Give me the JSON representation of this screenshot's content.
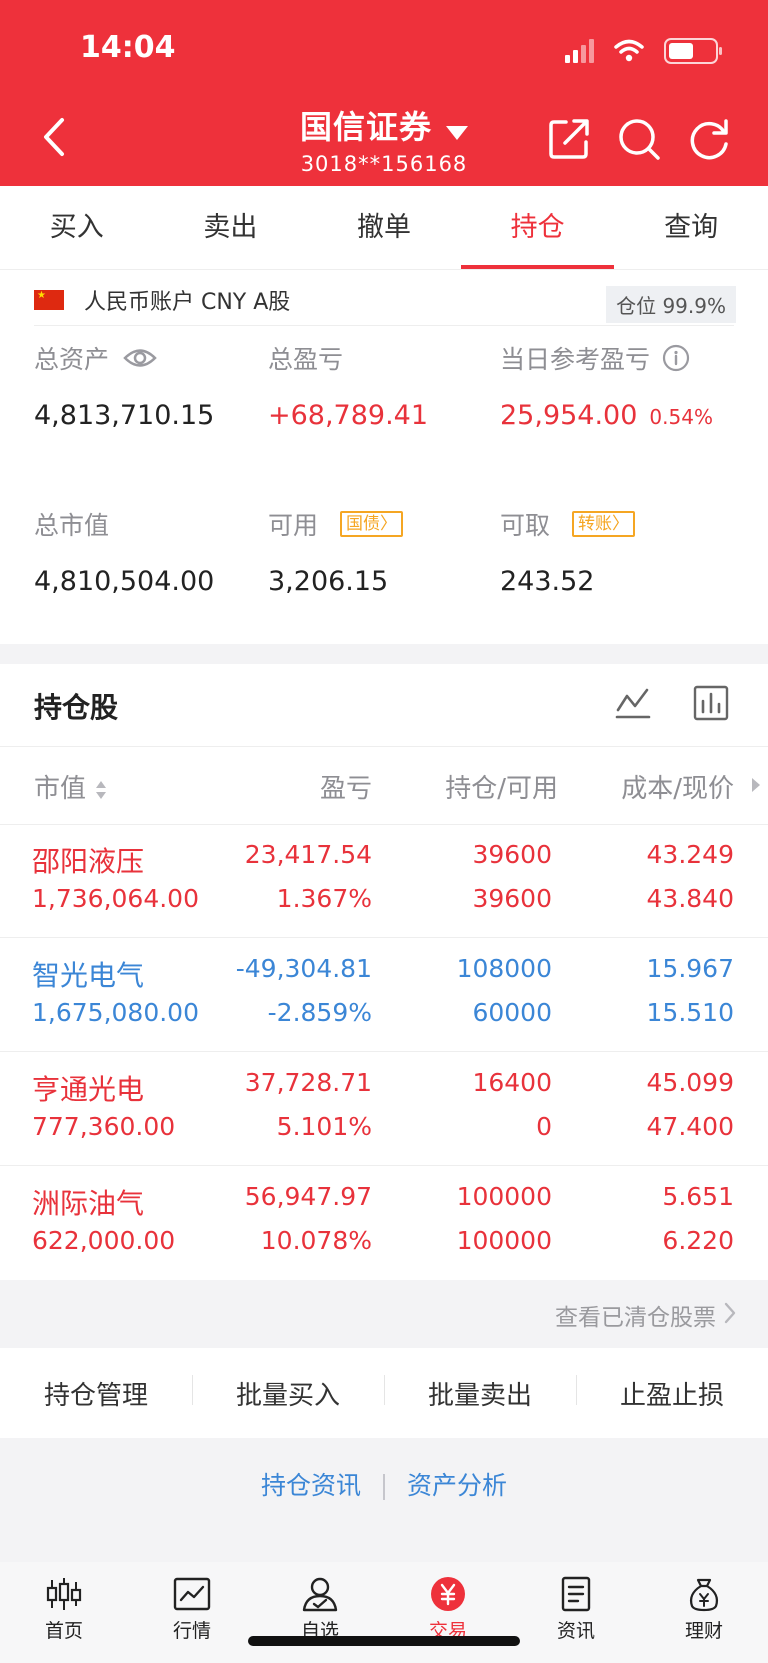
{
  "status_bar": {
    "time": "14:04"
  },
  "header": {
    "title": "国信证券",
    "account_no": "3018**156168"
  },
  "tabs": [
    {
      "label": "买入",
      "active": false
    },
    {
      "label": "卖出",
      "active": false
    },
    {
      "label": "撤单",
      "active": false
    },
    {
      "label": "持仓",
      "active": true
    },
    {
      "label": "查询",
      "active": false
    }
  ],
  "account": {
    "label": "人民币账户 CNY A股",
    "position_ratio": "仓位 99.9%",
    "total_assets": {
      "label": "总资产",
      "value": "4,813,710.15"
    },
    "total_pnl": {
      "label": "总盈亏",
      "value": "+68,789.41"
    },
    "day_pnl": {
      "label": "当日参考盈亏",
      "value": "25,954.00",
      "pct": "0.54%"
    },
    "market_value": {
      "label": "总市值",
      "value": "4,810,504.00"
    },
    "available": {
      "label": "可用",
      "value": "3,206.15",
      "tag": "国债"
    },
    "withdrawable": {
      "label": "可取",
      "value": "243.52",
      "tag": "转账"
    }
  },
  "holdings": {
    "title": "持仓股",
    "columns": [
      "市值",
      "盈亏",
      "持仓/可用",
      "成本/现价"
    ],
    "rows": [
      {
        "name": "邵阳液压",
        "market_value": "1,736,064.00",
        "pnl": "23,417.54",
        "pnl_pct": "1.367%",
        "position": "39600",
        "available": "39600",
        "cost": "43.249",
        "price": "43.840",
        "trend": "up"
      },
      {
        "name": "智光电气",
        "market_value": "1,675,080.00",
        "pnl": "-49,304.81",
        "pnl_pct": "-2.859%",
        "position": "108000",
        "available": "60000",
        "cost": "15.967",
        "price": "15.510",
        "trend": "down"
      },
      {
        "name": "亨通光电",
        "market_value": "777,360.00",
        "pnl": "37,728.71",
        "pnl_pct": "5.101%",
        "position": "16400",
        "available": "0",
        "cost": "45.099",
        "price": "47.400",
        "trend": "up"
      },
      {
        "name": "洲际油气",
        "market_value": "622,000.00",
        "pnl": "56,947.97",
        "pnl_pct": "10.078%",
        "position": "100000",
        "available": "100000",
        "cost": "5.651",
        "price": "6.220",
        "trend": "up"
      }
    ],
    "cleared_link": "查看已清仓股票"
  },
  "actions": [
    "持仓管理",
    "批量买入",
    "批量卖出",
    "止盈止损"
  ],
  "links": [
    "持仓资讯",
    "资产分析"
  ],
  "bottom_nav": [
    {
      "label": "首页",
      "icon": "candlestick-icon",
      "active": false
    },
    {
      "label": "行情",
      "icon": "chart-icon",
      "active": false
    },
    {
      "label": "自选",
      "icon": "user-check-icon",
      "active": false
    },
    {
      "label": "交易",
      "icon": "yuan-icon",
      "active": true
    },
    {
      "label": "资讯",
      "icon": "document-icon",
      "active": false
    },
    {
      "label": "理财",
      "icon": "money-bag-icon",
      "active": false
    }
  ],
  "colors": {
    "brand_red": "#ee313b",
    "up": "#e8323b",
    "down": "#3b86d6",
    "tag": "#f5a623"
  }
}
